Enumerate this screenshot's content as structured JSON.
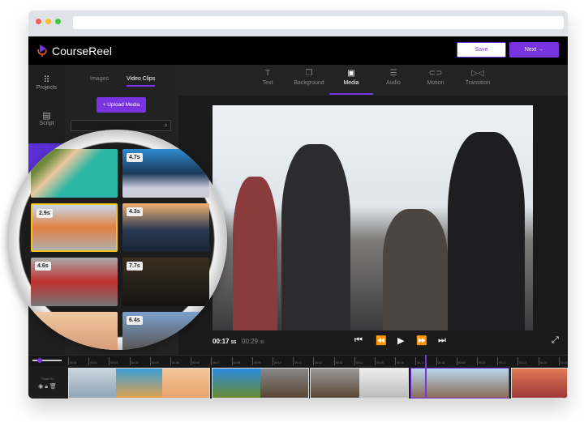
{
  "app": {
    "name": "CourseReel",
    "save": "Save",
    "next": "Next →"
  },
  "rail": [
    {
      "label": "Projects",
      "icon": "grid-icon"
    },
    {
      "label": "Script",
      "icon": "document-icon"
    }
  ],
  "panel": {
    "tabs": [
      "Images",
      "Video Clips"
    ],
    "active_tab": "Video Clips",
    "upload": "+ Upload Media",
    "clips": [
      {
        "duration": ""
      },
      {
        "duration": "4.7s"
      },
      {
        "duration": "2.9s"
      },
      {
        "duration": "4.3s"
      },
      {
        "duration": "4.6s"
      },
      {
        "duration": "7.7s"
      },
      {
        "duration": ""
      },
      {
        "duration": "6.4s"
      }
    ]
  },
  "tools": [
    {
      "label": "Text",
      "icon": "T"
    },
    {
      "label": "Background",
      "icon": "❐"
    },
    {
      "label": "Media",
      "icon": "▣"
    },
    {
      "label": "Audio",
      "icon": "☰"
    },
    {
      "label": "Motion",
      "icon": "⊂⊃"
    },
    {
      "label": "Transition",
      "icon": "▷◁"
    }
  ],
  "player": {
    "current": "00:17",
    "current_unit": "SS",
    "total": "00:29",
    "total_unit": "00"
  },
  "timeline": {
    "track_label": "Track 01",
    "ticks": [
      "00:00",
      "00:01",
      "00:02",
      "00:03",
      "00:04",
      "00:05",
      "00:06",
      "00:07",
      "00:08",
      "00:09",
      "00:10",
      "00:11",
      "00:12",
      "00:13",
      "00:14",
      "00:15",
      "00:16",
      "00:17",
      "00:18",
      "00:19",
      "00:20",
      "00:21",
      "00:22",
      "00:23",
      "00:24"
    ]
  },
  "colors": {
    "accent": "#7a33e0",
    "selected": "#f0c419"
  }
}
